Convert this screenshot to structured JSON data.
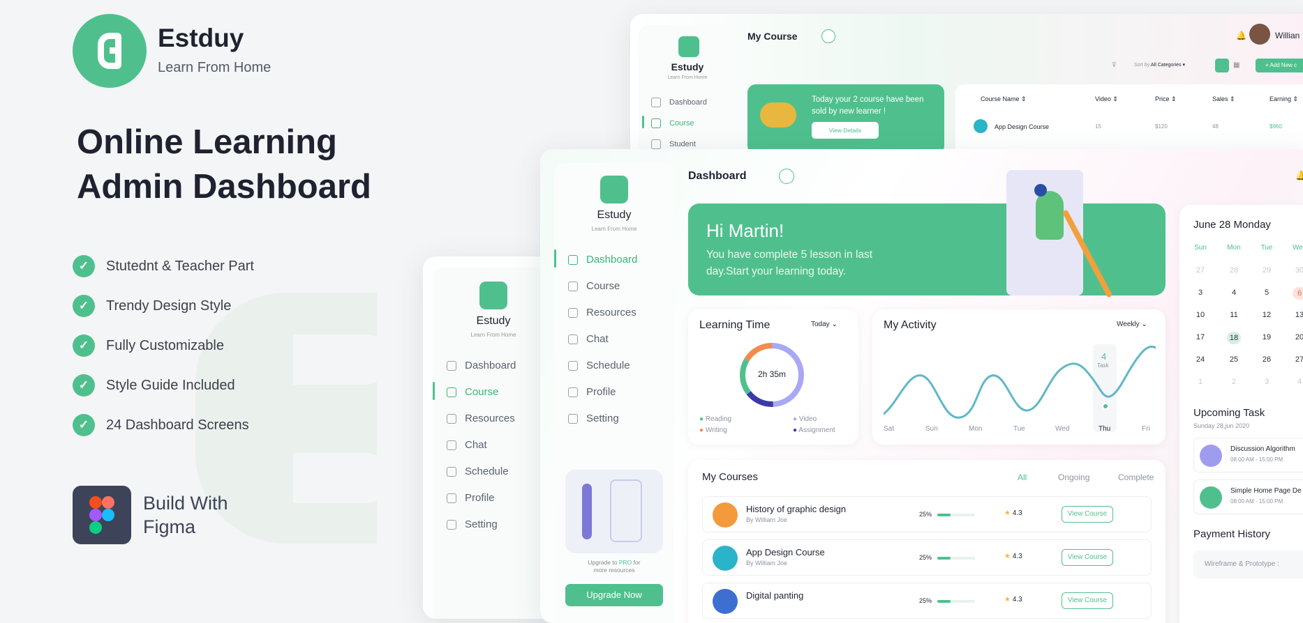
{
  "brand": {
    "name": "Estduy",
    "tagline": "Learn From Home"
  },
  "headline": {
    "line1": "Online Learning",
    "line2": "Admin Dashboard"
  },
  "features": [
    "Stutednt & Teacher Part",
    "Trendy Design Style",
    "Fully Customizable",
    "Style Guide Included",
    "24 Dashboard Screens"
  ],
  "build": {
    "line1": "Build With",
    "line2": "Figma"
  },
  "colors": {
    "accent": "#4fc08d",
    "dark": "#1f2230"
  },
  "back": {
    "title": "My Course",
    "user": "Willian",
    "logo_name": "Estudy",
    "logo_tag": "Learn From Home",
    "nav": [
      "Dashboard",
      "Course",
      "Student"
    ],
    "sort_label": "Sort by:",
    "sort_value": "All Categories",
    "add_label": "+ Add New c",
    "promo": "Today your 2 course have been sold by new learner !",
    "promo_btn": "View Details",
    "cols": [
      "Course Name",
      "Video",
      "Price",
      "Sales",
      "Earning"
    ],
    "row": {
      "name": "App Design Course",
      "video": "15",
      "price": "$120",
      "sales": "48",
      "earning": "$960"
    }
  },
  "left": {
    "logo_name": "Estudy",
    "logo_tag": "Learn From Home",
    "nav": [
      "Dashboard",
      "Course",
      "Resources",
      "Chat",
      "Schedule",
      "Profile",
      "Setting"
    ]
  },
  "front": {
    "logo_name": "Estudy",
    "logo_tag": "Learn From Home",
    "nav": [
      "Dashboard",
      "Course",
      "Resources",
      "Chat",
      "Schedule",
      "Profile",
      "Setting"
    ],
    "title": "Dashboard",
    "hero_title": "Hi Martin!",
    "hero_text": "You have complete 5 lesson in last day.Start your learning today.",
    "upgrade_text1": "Upgrade",
    "upgrade_to": "to",
    "upgrade_pro": "PRO",
    "upgrade_for": "for",
    "upgrade_text2": "more resources",
    "upgrade_btn": "Upgrade Now",
    "learning": {
      "title": "Learning Time",
      "period": "Today",
      "center": "2h 35m",
      "legend": [
        "Reading",
        "Video",
        "Writing",
        "Assignment"
      ]
    },
    "activity": {
      "title": "My Activity",
      "period": "Weekly",
      "days": [
        "Sat",
        "Sun",
        "Mon",
        "Tue",
        "Wed",
        "Thu",
        "Fri"
      ],
      "peak_value": "4",
      "peak_label": "Task"
    },
    "courses": {
      "title": "My Courses",
      "tabs": [
        "All",
        "Ongoing",
        "Complete"
      ],
      "items": [
        {
          "name": "History of graphic design",
          "by": "By William Joe",
          "pct": "25%",
          "rating": "4.3",
          "btn": "View Course"
        },
        {
          "name": "App Design Course",
          "by": "By William Joe",
          "pct": "25%",
          "rating": "4.3",
          "btn": "View Course"
        },
        {
          "name": "Digital panting",
          "by": "",
          "pct": "25%",
          "rating": "4.3",
          "btn": "View Course"
        }
      ]
    },
    "calendar": {
      "title": "June 28 Monday",
      "days": [
        "Sun",
        "Mon",
        "Tue",
        "Wed"
      ],
      "weeks": [
        [
          "27",
          "28",
          "29",
          "30"
        ],
        [
          "3",
          "4",
          "5",
          "6"
        ],
        [
          "10",
          "11",
          "12",
          "13"
        ],
        [
          "17",
          "18",
          "19",
          "20"
        ],
        [
          "24",
          "25",
          "26",
          "27"
        ],
        [
          "1",
          "2",
          "3",
          "4"
        ]
      ]
    },
    "upcoming": {
      "title": "Upcoming Task",
      "date": "Sunday 28,jun 2020",
      "items": [
        {
          "name": "Discussion Algorithm",
          "time": "08:00 AM - 15:00 PM"
        },
        {
          "name": "Simple Home Page De",
          "time": "08:00 AM - 15:00 PM"
        }
      ]
    },
    "payment": {
      "title": "Payment History",
      "item": "Wireframe & Prototype :"
    }
  }
}
